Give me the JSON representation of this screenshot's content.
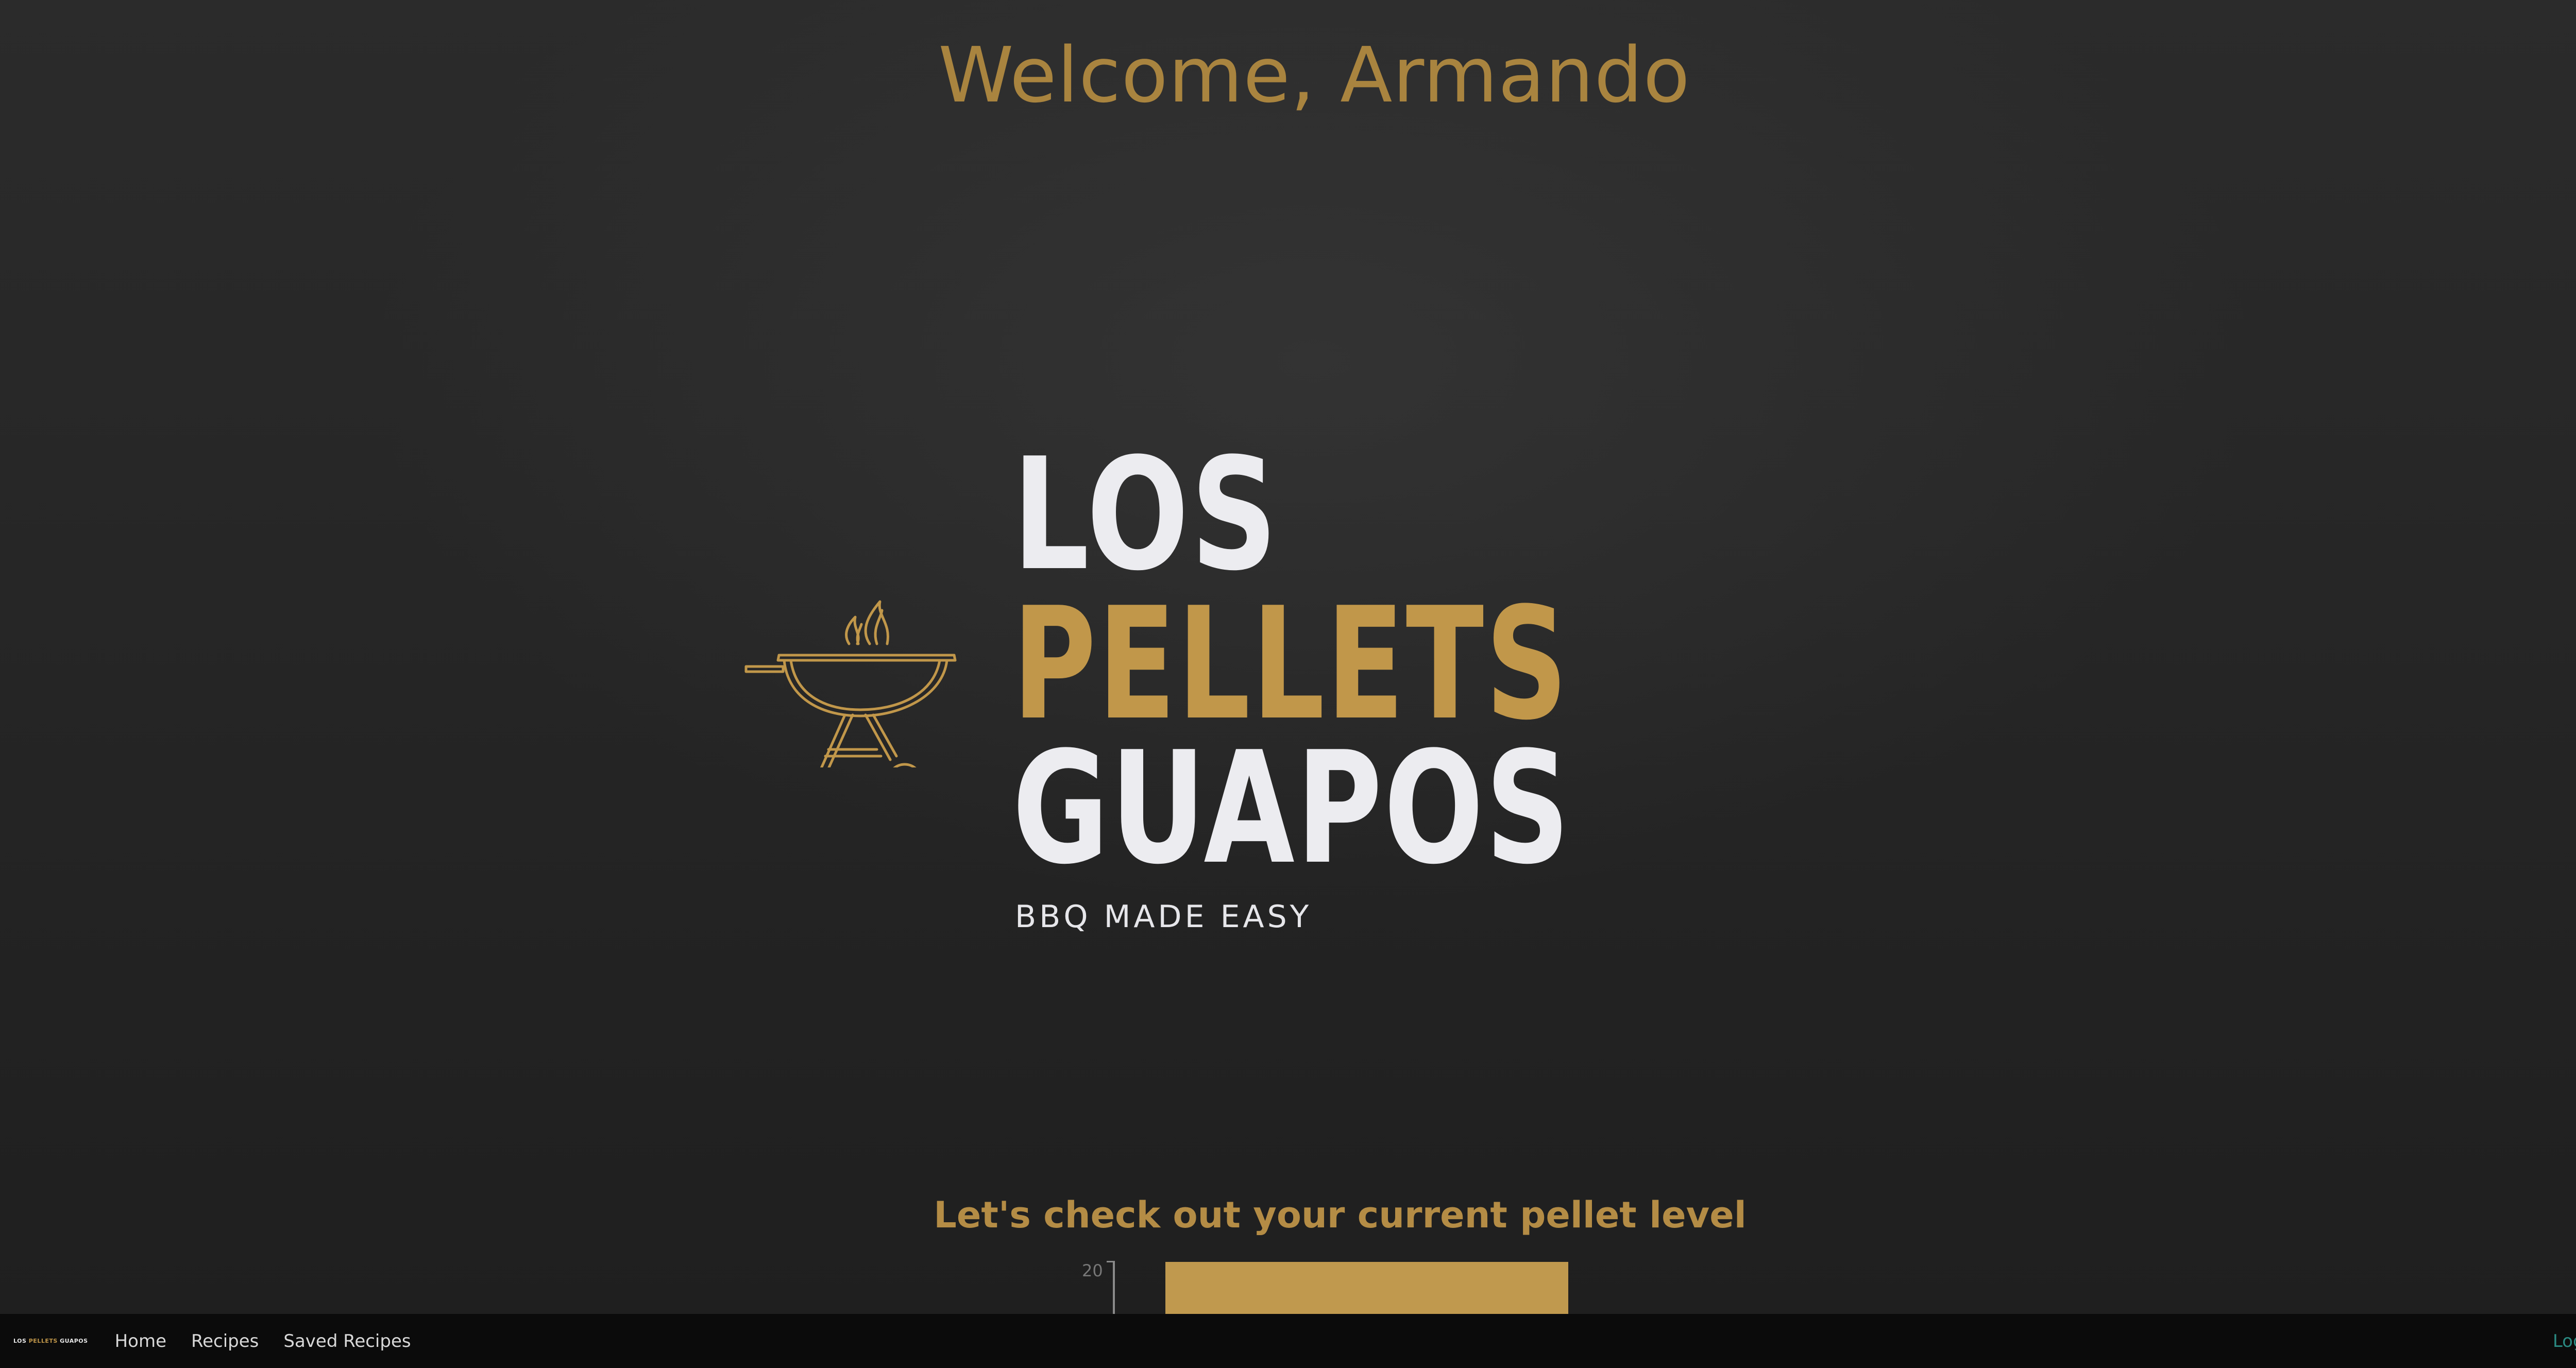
{
  "welcome": {
    "text": "Welcome, Armando"
  },
  "logo": {
    "line1": "LOS",
    "line2": "PELLETS",
    "line3": "GUAPOS",
    "tagline": "BBQ MADE EASY",
    "icon": "grill-icon",
    "colors": {
      "gold": "#c1974a",
      "white": "#ececf0"
    }
  },
  "pellet_section": {
    "heading": "Let's check out your current pellet level"
  },
  "chart_data": {
    "type": "bar",
    "categories": [
      ""
    ],
    "values": [
      20
    ],
    "title": "",
    "xlabel": "",
    "ylabel": "",
    "y_ticks": [
      "20"
    ],
    "bar_color": "#c0994e"
  },
  "navbar": {
    "brand": {
      "part1": "LOS ",
      "part2": "PELLETS ",
      "part3": "GUAPOS"
    },
    "links": {
      "home": "Home",
      "recipes": "Recipes",
      "saved": "Saved Recipes"
    },
    "logout": "Log Out",
    "colors": {
      "background": "#0b0b0b",
      "logout": "#2a8a82"
    }
  }
}
